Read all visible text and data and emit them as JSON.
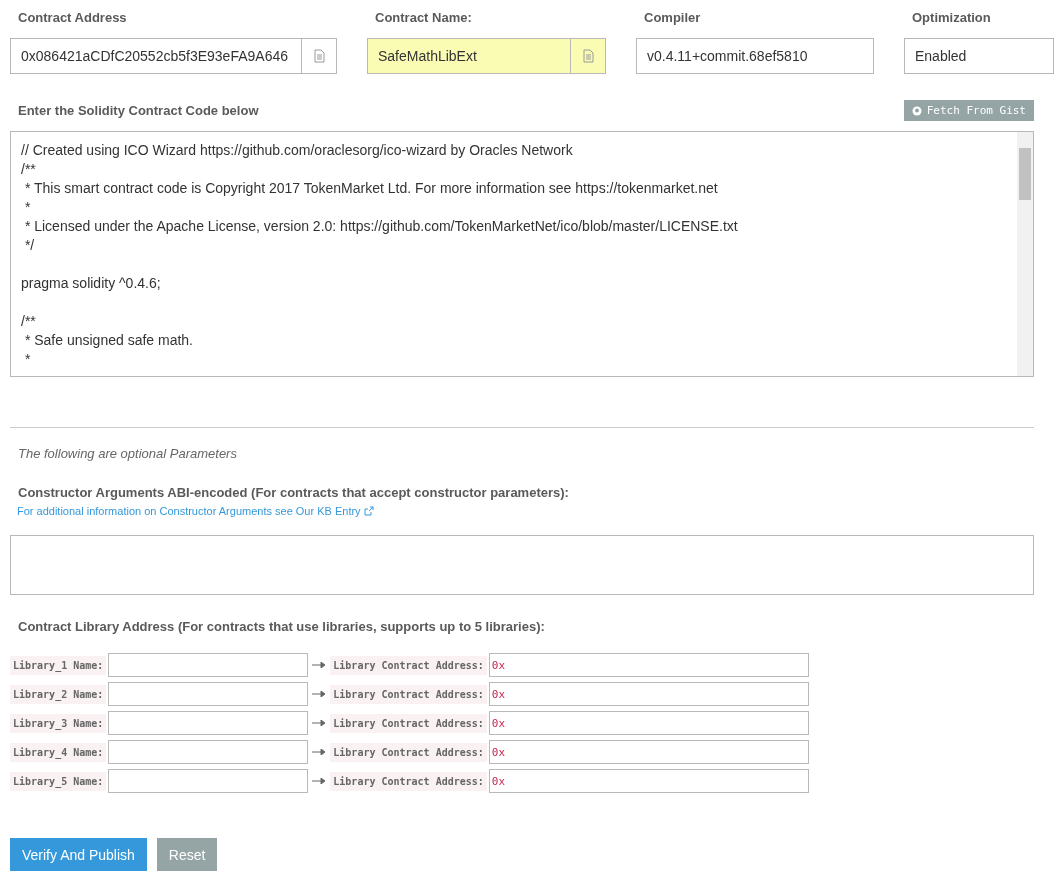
{
  "fields": [
    {
      "label": "Contract Address",
      "value": "0x086421aCDfC20552cb5f3E93eFA9A646",
      "kind": "with_icon",
      "highlighted": false
    },
    {
      "label": "Contract Name:",
      "value": "SafeMathLibExt",
      "kind": "with_icon",
      "highlighted": true
    },
    {
      "label": "Compiler",
      "value": "v0.4.11+commit.68ef5810",
      "kind": "plain",
      "highlighted": false
    },
    {
      "label": "Optimization",
      "value": "Enabled",
      "kind": "plain",
      "highlighted": false
    }
  ],
  "code_section": {
    "label": "Enter the Solidity Contract Code below",
    "fetch_button": "Fetch From Gist",
    "code": "// Created using ICO Wizard https://github.com/oraclesorg/ico-wizard by Oracles Network\n/**\n * This smart contract code is Copyright 2017 TokenMarket Ltd. For more information see https://tokenmarket.net\n *\n * Licensed under the Apache License, version 2.0: https://github.com/TokenMarketNet/ico/blob/master/LICENSE.txt\n */\n\npragma solidity ^0.4.6;\n\n/**\n * Safe unsigned safe math.\n *"
  },
  "optional_note": "The following are optional Parameters",
  "constructor": {
    "label": "Constructor Arguments ABI-encoded (For contracts that accept constructor parameters):",
    "link": "For additional information on Constructor Arguments see Our KB Entry"
  },
  "libraries": {
    "label": "Contract Library Address (For contracts that use libraries, supports up to 5 libraries):",
    "rows": [
      {
        "name_label": "Library_1 Name:",
        "address_label": "Library Contract Address:",
        "address_value": "0x"
      },
      {
        "name_label": "Library_2 Name:",
        "address_label": "Library Contract Address:",
        "address_value": "0x"
      },
      {
        "name_label": "Library_3 Name:",
        "address_label": "Library Contract Address:",
        "address_value": "0x"
      },
      {
        "name_label": "Library_4 Name:",
        "address_label": "Library Contract Address:",
        "address_value": "0x"
      },
      {
        "name_label": "Library_5 Name:",
        "address_label": "Library Contract Address:",
        "address_value": "0x"
      }
    ]
  },
  "buttons": [
    {
      "label": "Verify And Publish",
      "kind": "primary"
    },
    {
      "label": "Reset",
      "kind": "secondary"
    }
  ]
}
